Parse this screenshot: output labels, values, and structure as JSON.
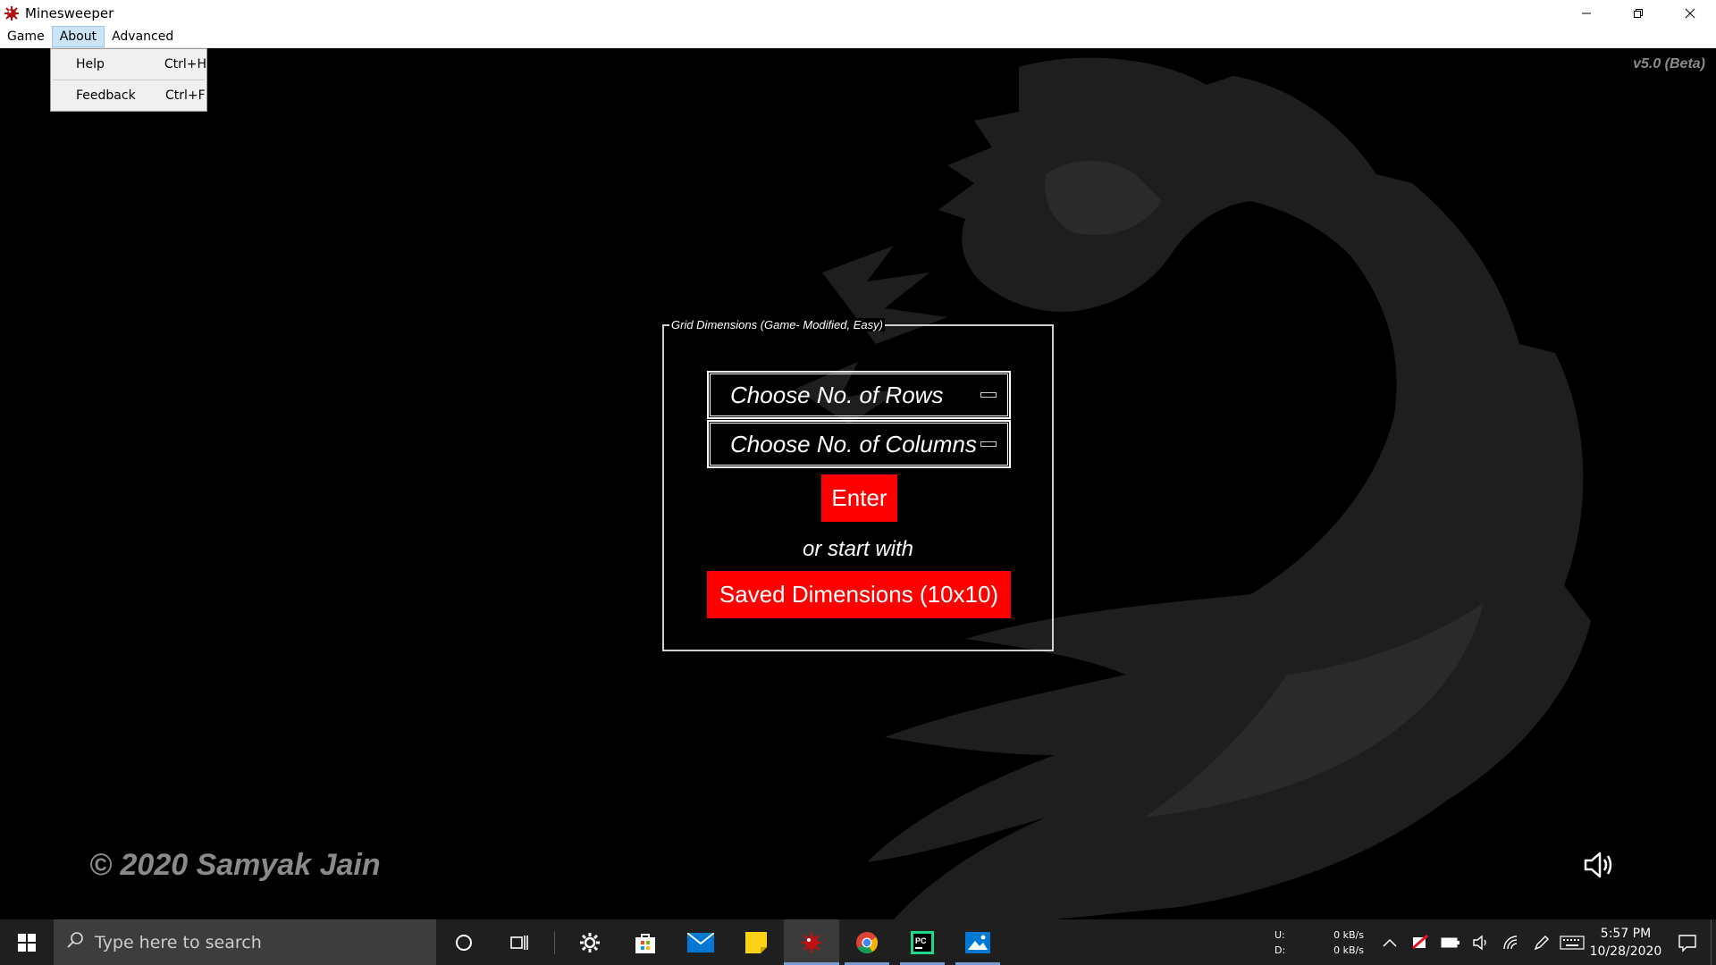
{
  "window": {
    "title": "Minesweeper",
    "app_icon": "mine-icon"
  },
  "menubar": {
    "items": [
      "Game",
      "About",
      "Advanced"
    ],
    "active": "About"
  },
  "about_menu": {
    "items": [
      {
        "label": "Help",
        "shortcut": "Ctrl+H"
      },
      {
        "label": "Feedback",
        "shortcut": "Ctrl+F"
      }
    ]
  },
  "main": {
    "version": "v5.0 (Beta)",
    "grid_group_title": "Grid Dimensions (Game- Modified, Easy)",
    "rows_select": "Choose No. of Rows",
    "cols_select": "Choose No. of Columns",
    "enter_label": "Enter",
    "or_text": "or start with",
    "saved_label": "Saved Dimensions (10x10)",
    "copyright": "© 2020 Samyak Jain",
    "accent_color": "#ff0000",
    "sound_icon": "speaker-icon"
  },
  "taskbar": {
    "search_placeholder": "Type here to search",
    "pinned": [
      "cortana-icon",
      "task-view-icon",
      "settings-icon",
      "store-icon",
      "mail-icon",
      "sticky-notes-icon",
      "minesweeper-icon",
      "chrome-icon",
      "pycharm-icon",
      "photos-icon"
    ],
    "net_upload_label": "U:",
    "net_download_label": "D:",
    "net_upload": "0 kB/s",
    "net_download": "0 kB/s",
    "time": "5:57 PM",
    "date": "10/28/2020"
  }
}
